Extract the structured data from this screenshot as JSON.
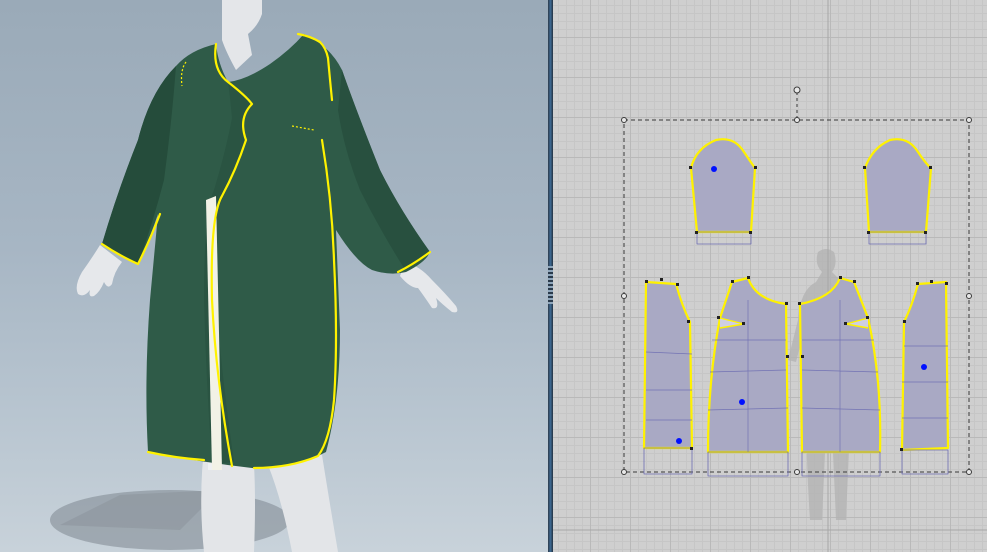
{
  "app": {
    "panes": [
      "3d-garment-view",
      "2d-pattern-view"
    ]
  },
  "colors": {
    "background_3d": "#a7b6c4",
    "garment": "#2f5b48",
    "avatar_skin": "#e7e9ec",
    "selection_outline": "#fff200",
    "pattern_fill": "#a9a9c4",
    "grid": "#cfcfcf",
    "pin_marker": "#0010ff",
    "divider": "#3d6a95"
  },
  "icons": {
    "bounding_box_handle": "square-handle-icon",
    "rotate_handle": "circle-handle-icon",
    "pin": "blue-dot-icon"
  },
  "selection": {
    "bounding_box": "dashed"
  }
}
